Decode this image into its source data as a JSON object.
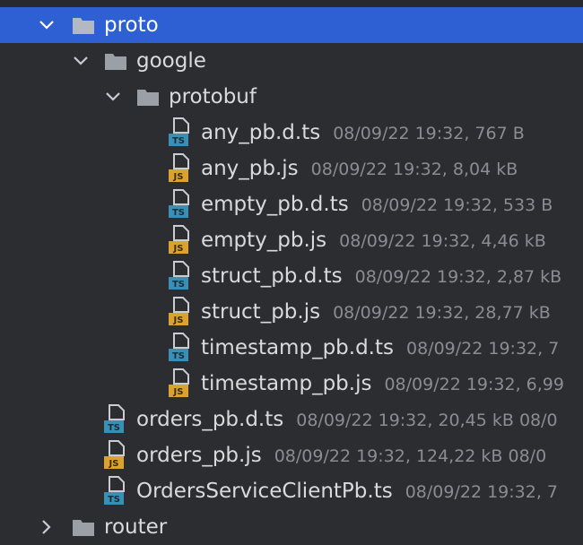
{
  "colors": {
    "background": "#2b2d30",
    "selection": "#2e5fd3",
    "folder": "#9aa0a6",
    "ts_badge": "#3a8fb7",
    "js_badge": "#d9a32e",
    "meta_text": "#8a8d91"
  },
  "tree": {
    "proto": {
      "label": "proto",
      "icon": "folder-icon",
      "expanded": true,
      "selected": true
    },
    "google": {
      "label": "google",
      "icon": "folder-icon",
      "expanded": true
    },
    "protobuf": {
      "label": "protobuf",
      "icon": "folder-icon",
      "expanded": true
    },
    "files": [
      {
        "name": "any_pb.d.ts",
        "meta": "08/09/22 19:32, 767 B",
        "type": "TS"
      },
      {
        "name": "any_pb.js",
        "meta": "08/09/22 19:32, 8,04 kB",
        "type": "JS"
      },
      {
        "name": "empty_pb.d.ts",
        "meta": "08/09/22 19:32, 533 B",
        "type": "TS"
      },
      {
        "name": "empty_pb.js",
        "meta": "08/09/22 19:32, 4,46 kB",
        "type": "JS"
      },
      {
        "name": "struct_pb.d.ts",
        "meta": "08/09/22 19:32, 2,87 kB",
        "type": "TS"
      },
      {
        "name": "struct_pb.js",
        "meta": "08/09/22 19:32, 28,77 kB",
        "type": "JS"
      },
      {
        "name": "timestamp_pb.d.ts",
        "meta": "08/09/22 19:32, 7",
        "type": "TS"
      },
      {
        "name": "timestamp_pb.js",
        "meta": "08/09/22 19:32, 6,99",
        "type": "JS"
      }
    ],
    "proto_files": [
      {
        "name": "orders_pb.d.ts",
        "meta": "08/09/22 19:32, 20,45 kB 08/0",
        "type": "TS"
      },
      {
        "name": "orders_pb.js",
        "meta": "08/09/22 19:32, 124,22 kB 08/0",
        "type": "JS"
      },
      {
        "name": "OrdersServiceClientPb.ts",
        "meta": "08/09/22 19:32, 7",
        "type": "TS"
      }
    ],
    "router": {
      "label": "router",
      "icon": "folder-icon",
      "expanded": false
    }
  }
}
